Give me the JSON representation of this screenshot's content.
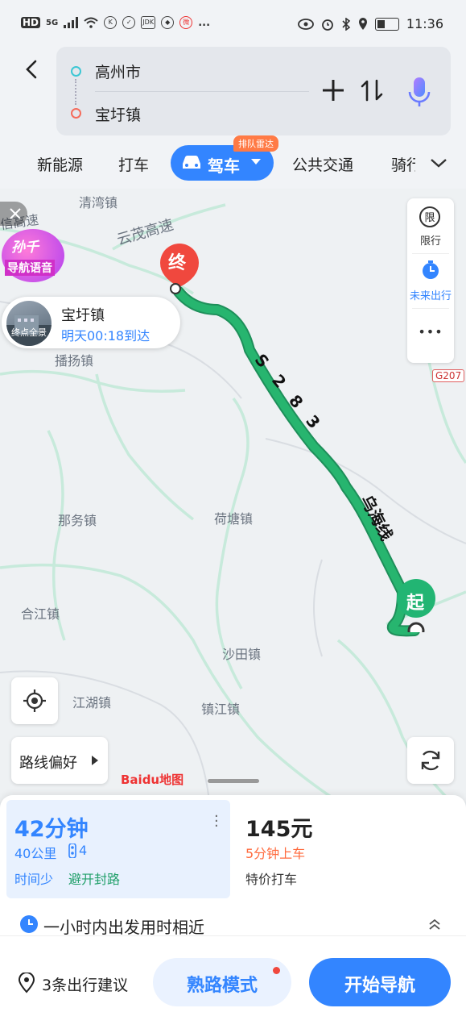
{
  "status_bar": {
    "left_icons": [
      "HD",
      "5G",
      "signal-icon",
      "wifi-icon",
      "K",
      "app-icon",
      "JDK",
      "app2-icon",
      "weibo-icon",
      "..."
    ],
    "time": "11:36"
  },
  "route": {
    "origin": "高州市",
    "destination": "宝圩镇"
  },
  "tabs": {
    "items": [
      "新能源",
      "打车",
      "驾车",
      "公共交通",
      "骑行"
    ],
    "active": "驾车",
    "badge": "排队雷达"
  },
  "map": {
    "labels": {
      "qingwan": "清湾镇",
      "yunmao_highway": "云茂高速",
      "highway_partial": "信高速",
      "boyang": "播扬镇",
      "nawu": "那务镇",
      "hetang": "荷塘镇",
      "hejiang": "合江镇",
      "shatian": "沙田镇",
      "jianghu": "江湖镇",
      "zhenjiang": "镇江镇",
      "s283": "S 2 8 3",
      "wuhai": "乌海线",
      "g207": "G207"
    },
    "end_marker": "终",
    "start_marker": "起",
    "dest_card": {
      "name": "宝圩镇",
      "arrival": "明天00:18到达",
      "thumb_label": "终点全景"
    },
    "promo": {
      "line1": "孙千",
      "line2": "导航语音"
    },
    "side_controls": {
      "limit_icon": "限",
      "limit_label": "限行",
      "future_label": "未来出行",
      "more": "•••"
    },
    "route_pref_label": "路线偏好",
    "baidu_logo": "Baidu地图"
  },
  "routes": {
    "primary": {
      "duration": "42分钟",
      "distance": "40公里",
      "traffic_lights": "4",
      "tag1": "时间少",
      "tag2": "避开封路"
    },
    "taxi": {
      "price": "145元",
      "pickup": "5分钟上车",
      "type": "特价打车"
    }
  },
  "departure_hint": "一小时内出发用时相近",
  "footer": {
    "suggestions": "3条出行建议",
    "familiar_mode": "熟路模式",
    "start_nav": "开始导航"
  },
  "colors": {
    "accent": "#3385ff",
    "route_green": "#22b573",
    "end_red": "#f0483e",
    "taxi_orange": "#ff6a3d"
  }
}
